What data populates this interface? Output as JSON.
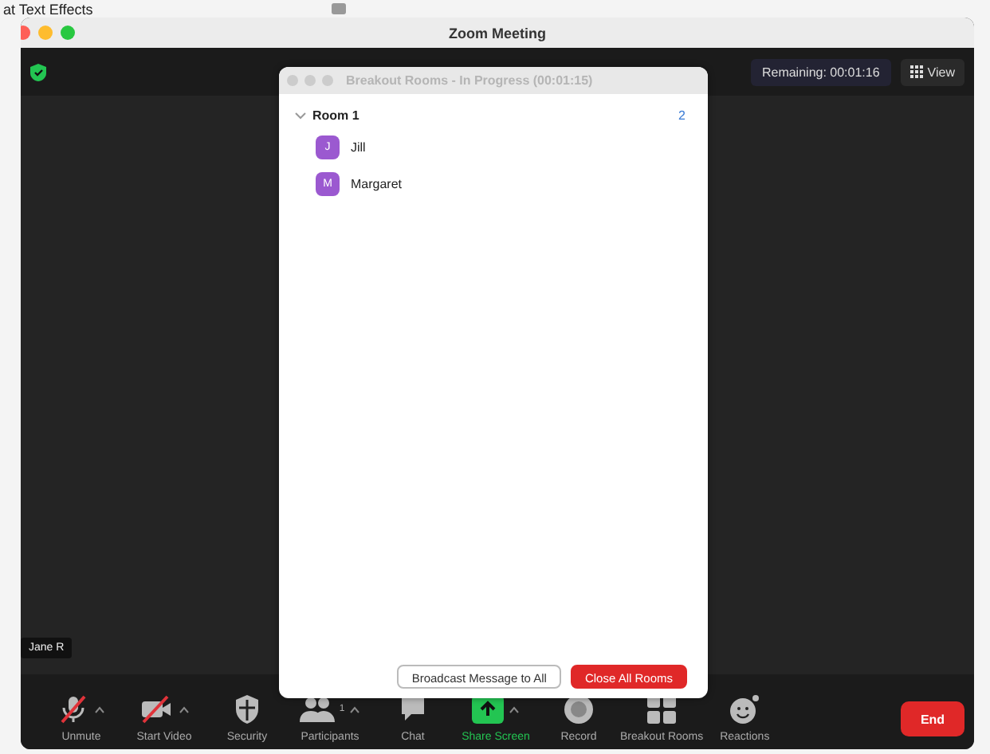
{
  "background_app": {
    "text": "at Text Effects"
  },
  "window": {
    "title": "Zoom Meeting"
  },
  "top_bar": {
    "remaining": "Remaining: 00:01:16",
    "view_button": "View"
  },
  "video": {
    "name_tag": "Jane R"
  },
  "breakout_dialog": {
    "title": "Breakout Rooms - In Progress (00:01:15)",
    "rooms": [
      {
        "name": "Room 1",
        "count": "2",
        "expanded": true,
        "members": [
          {
            "initial": "J",
            "name": "Jill"
          },
          {
            "initial": "M",
            "name": "Margaret"
          }
        ]
      }
    ],
    "buttons": [
      {
        "label": "Broadcast Message to All",
        "kind": "secondary"
      },
      {
        "label": "Close All Rooms",
        "kind": "danger"
      }
    ]
  },
  "toolbar": [
    {
      "label": "Unmute",
      "caret": true,
      "active": false
    },
    {
      "label": "Start Video",
      "caret": true,
      "active": false
    },
    {
      "label": "Security",
      "caret": false,
      "active": false
    },
    {
      "label": "Participants",
      "caret": true,
      "active": false,
      "count": "1"
    },
    {
      "label": "Chat",
      "caret": false,
      "active": false
    },
    {
      "label": "Share Screen",
      "caret": true,
      "active": true
    },
    {
      "label": "Record",
      "caret": false,
      "active": false
    },
    {
      "label": "Breakout Rooms",
      "caret": false,
      "active": false
    },
    {
      "label": "Reactions",
      "caret": false,
      "active": false
    }
  ],
  "end_button": "End"
}
